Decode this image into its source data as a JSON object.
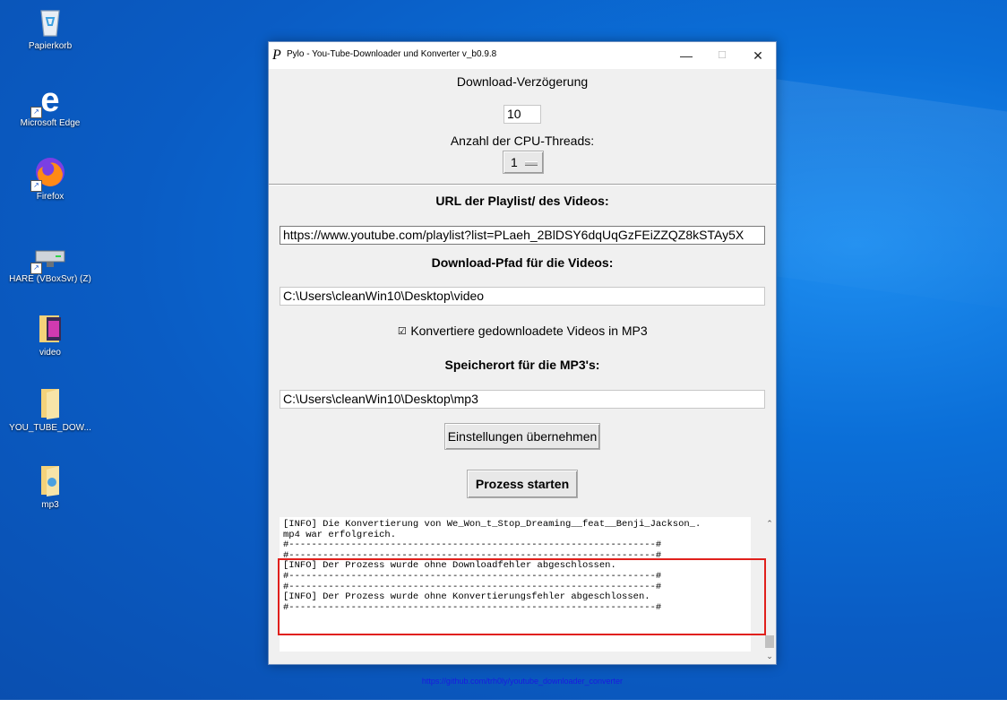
{
  "desktop": {
    "icons": [
      {
        "label": "Papierkorb",
        "icon": "recycle-bin-icon"
      },
      {
        "label": "Microsoft Edge",
        "icon": "edge-icon"
      },
      {
        "label": "Firefox",
        "icon": "firefox-icon"
      },
      {
        "label": "HARE (VBoxSvr) (Z)",
        "icon": "network-drive-icon"
      },
      {
        "label": "video",
        "icon": "folder-video-icon"
      },
      {
        "label": "YOU_TUBE_DOW...",
        "icon": "folder-icon"
      },
      {
        "label": "mp3",
        "icon": "folder-music-icon"
      }
    ]
  },
  "window": {
    "title": "Pylo - You-Tube-Downloader und Konverter v_b0.9.8",
    "controls": {
      "minimize": "—",
      "maximize": "☐",
      "close": "✕"
    }
  },
  "settings": {
    "delay_label": "Download-Verzögerung",
    "delay_value": "10",
    "threads_label": "Anzahl der CPU-Threads:",
    "threads_value": "1"
  },
  "form": {
    "url_label": "URL der Playlist/ des Videos:",
    "url_value": "https://www.youtube.com/playlist?list=PLaeh_2BlDSY6dqUqGzFEiZZQZ8kSTAy5X",
    "download_path_label": "Download-Pfad für die Videos:",
    "download_path_value": "C:\\Users\\cleanWin10\\Desktop\\video",
    "convert_checkbox_label": "Konvertiere gedownloadete Videos in MP3",
    "convert_checked": true,
    "mp3_path_label": "Speicherort für die MP3's:",
    "mp3_path_value": "C:\\Users\\cleanWin10\\Desktop\\mp3",
    "apply_button": "Einstellungen übernehmen",
    "start_button": "Prozess starten"
  },
  "log": {
    "lines": [
      "[INFO] Die Konvertierung von We_Won_t_Stop_Dreaming__feat__Benji_Jackson_.",
      "mp4 war erfolgreich.",
      "#-----------------------------------------------------------------#",
      "#-----------------------------------------------------------------#",
      "[INFO] Der Prozess wurde ohne Downloadfehler abgeschlossen.",
      "#-----------------------------------------------------------------#",
      "#-----------------------------------------------------------------#",
      "[INFO] Der Prozess wurde ohne Konvertierungsfehler abgeschlossen.",
      "#-----------------------------------------------------------------#"
    ]
  },
  "footer": {
    "link": "https://github.com/trh0ly/youtube_downloader_converter"
  },
  "colors": {
    "highlight_box": "#e0201c",
    "link": "#1a1ae0",
    "desktop_blue": "#0a5cc4"
  }
}
